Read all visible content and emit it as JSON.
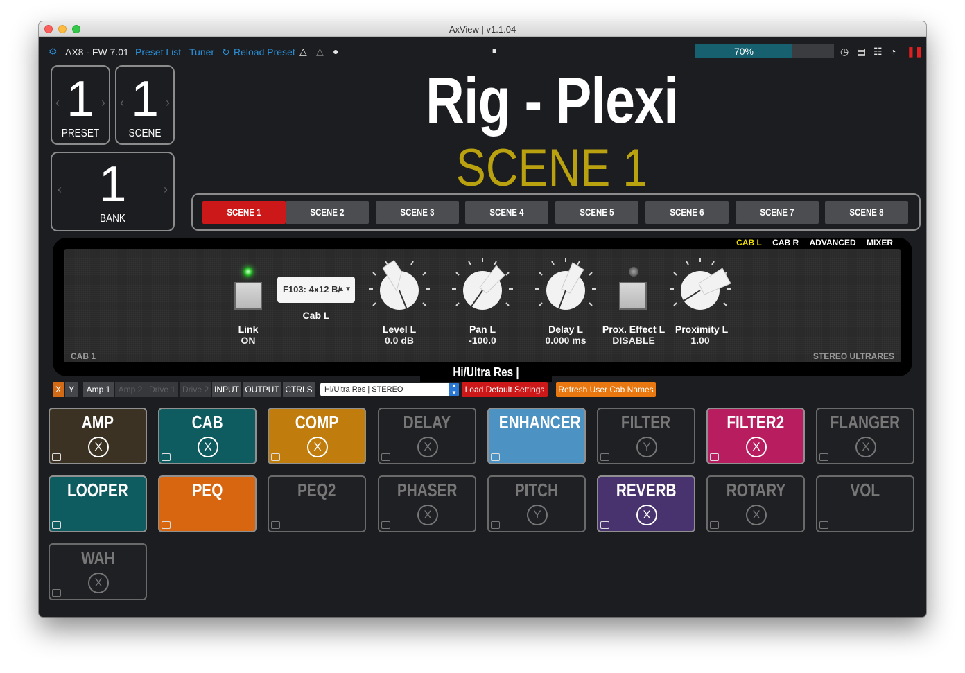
{
  "window": {
    "title": "AxView | v1.1.04"
  },
  "toolbar": {
    "device": "AX8 - FW 7.01",
    "preset_list": "Preset List",
    "tuner": "Tuner",
    "reload_preset": "Reload Preset",
    "cpu_percent_label": "70%",
    "cpu_percent": 70
  },
  "selectors": {
    "preset": {
      "value": "1",
      "label": "PRESET"
    },
    "scene": {
      "value": "1",
      "label": "SCENE"
    },
    "bank": {
      "value": "1",
      "label": "BANK"
    }
  },
  "preset_name": "Rig - Plexi",
  "scene_name": "SCENE 1",
  "scenes": [
    "SCENE 1",
    "SCENE 2",
    "SCENE 3",
    "SCENE 4",
    "SCENE 5",
    "SCENE 6",
    "SCENE 7",
    "SCENE 8"
  ],
  "active_scene_index": 0,
  "cab_tabs": [
    "CAB L",
    "CAB R",
    "ADVANCED",
    "MIXER"
  ],
  "cab_panel": {
    "link": {
      "label": "Link",
      "value": "ON"
    },
    "cab_select": {
      "value": "F103: 4x12 B/",
      "label": "Cab L"
    },
    "level": {
      "label": "Level L",
      "value": "0.0 dB"
    },
    "pan": {
      "label": "Pan L",
      "value": "-100.0"
    },
    "delay": {
      "label": "Delay L",
      "value": "0.000 ms"
    },
    "prox_effect": {
      "label": "Prox. Effect L",
      "value": "DISABLE"
    },
    "proximity": {
      "label": "Proximity L",
      "value": "1.00"
    },
    "footer_left": "CAB 1",
    "footer_right": "STEREO ULTRARES",
    "mode_title": "Hi/Ultra Res | STEREO"
  },
  "control_row": {
    "x": "X",
    "y": "Y",
    "amp1": "Amp 1",
    "amp2": "Amp 2",
    "drive1": "Drive 1",
    "drive2": "Drive 2",
    "input": "INPUT",
    "output": "OUTPUT",
    "ctrls": "CTRLS",
    "mode_select": "Hi/Ultra Res | STEREO",
    "load_default": "Load Default Settings",
    "refresh_names": "Refresh User Cab Names"
  },
  "colors": {
    "accent_blue": "#2a8fd7",
    "scene_active": "#cc1818",
    "scene_title": "#b9a10f",
    "cpu_bar": "#16606f",
    "load_default_bg": "#cc1818",
    "refresh_bg": "#e8780f"
  },
  "blocks": [
    {
      "name": "AMP",
      "xy": "X",
      "color": "#3b3223",
      "on": true
    },
    {
      "name": "CAB",
      "xy": "X",
      "color": "#0e5b60",
      "on": true
    },
    {
      "name": "COMP",
      "xy": "X",
      "color": "#c07d0e",
      "on": true
    },
    {
      "name": "DELAY",
      "xy": "X",
      "color": "",
      "on": false
    },
    {
      "name": "ENHANCER",
      "xy": "",
      "color": "#4c93c4",
      "on": true
    },
    {
      "name": "FILTER",
      "xy": "Y",
      "color": "",
      "on": false
    },
    {
      "name": "FILTER2",
      "xy": "X",
      "color": "#b71d5f",
      "on": true
    },
    {
      "name": "FLANGER",
      "xy": "X",
      "color": "",
      "on": false
    },
    {
      "name": "LOOPER",
      "xy": "",
      "color": "#0e5b60",
      "on": true
    },
    {
      "name": "PEQ",
      "xy": "",
      "color": "#d8650f",
      "on": true
    },
    {
      "name": "PEQ2",
      "xy": "",
      "color": "",
      "on": false
    },
    {
      "name": "PHASER",
      "xy": "X",
      "color": "",
      "on": false
    },
    {
      "name": "PITCH",
      "xy": "Y",
      "color": "",
      "on": false
    },
    {
      "name": "REVERB",
      "xy": "X",
      "color": "#48336e",
      "on": true
    },
    {
      "name": "ROTARY",
      "xy": "X",
      "color": "",
      "on": false
    },
    {
      "name": "VOL",
      "xy": "",
      "color": "",
      "on": false
    },
    {
      "name": "WAH",
      "xy": "X",
      "color": "",
      "on": false
    }
  ]
}
